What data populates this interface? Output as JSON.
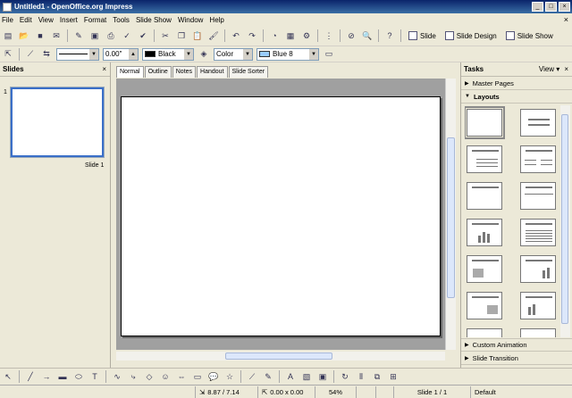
{
  "window": {
    "title": "Untitled1 - OpenOffice.org Impress",
    "minimize": "_",
    "maximize": "□",
    "close": "×"
  },
  "menu": [
    "File",
    "Edit",
    "View",
    "Insert",
    "Format",
    "Tools",
    "Slide Show",
    "Window",
    "Help"
  ],
  "menu_close": "×",
  "toolbar": {
    "slide_label": "Slide",
    "slide_design_label": "Slide Design",
    "slide_show_label": "Slide Show"
  },
  "line_toolbar": {
    "line_width": "0.00\"",
    "line_color": "Black",
    "line_color_hex": "#000000",
    "area_style": "Color",
    "area_color": "Blue 8",
    "area_color_hex": "#99ccff"
  },
  "slides_panel": {
    "title": "Slides",
    "close": "×",
    "slides": [
      {
        "number": "1",
        "name": "Slide 1"
      }
    ]
  },
  "view_tabs": [
    "Normal",
    "Outline",
    "Notes",
    "Handout",
    "Slide Sorter"
  ],
  "active_tab": "Normal",
  "tasks_panel": {
    "title": "Tasks",
    "view_label": "View ▾",
    "close": "×",
    "sections_top": [
      {
        "label": "Master Pages",
        "expanded": false
      },
      {
        "label": "Layouts",
        "expanded": true
      }
    ],
    "sections_bottom": [
      {
        "label": "Custom Animation",
        "expanded": false
      },
      {
        "label": "Slide Transition",
        "expanded": false
      }
    ]
  },
  "status": {
    "position": "8.87 / 7.14",
    "size": "0.00 x 0.00",
    "zoom": "54%",
    "slide": "Slide 1 / 1",
    "master": "Default"
  }
}
